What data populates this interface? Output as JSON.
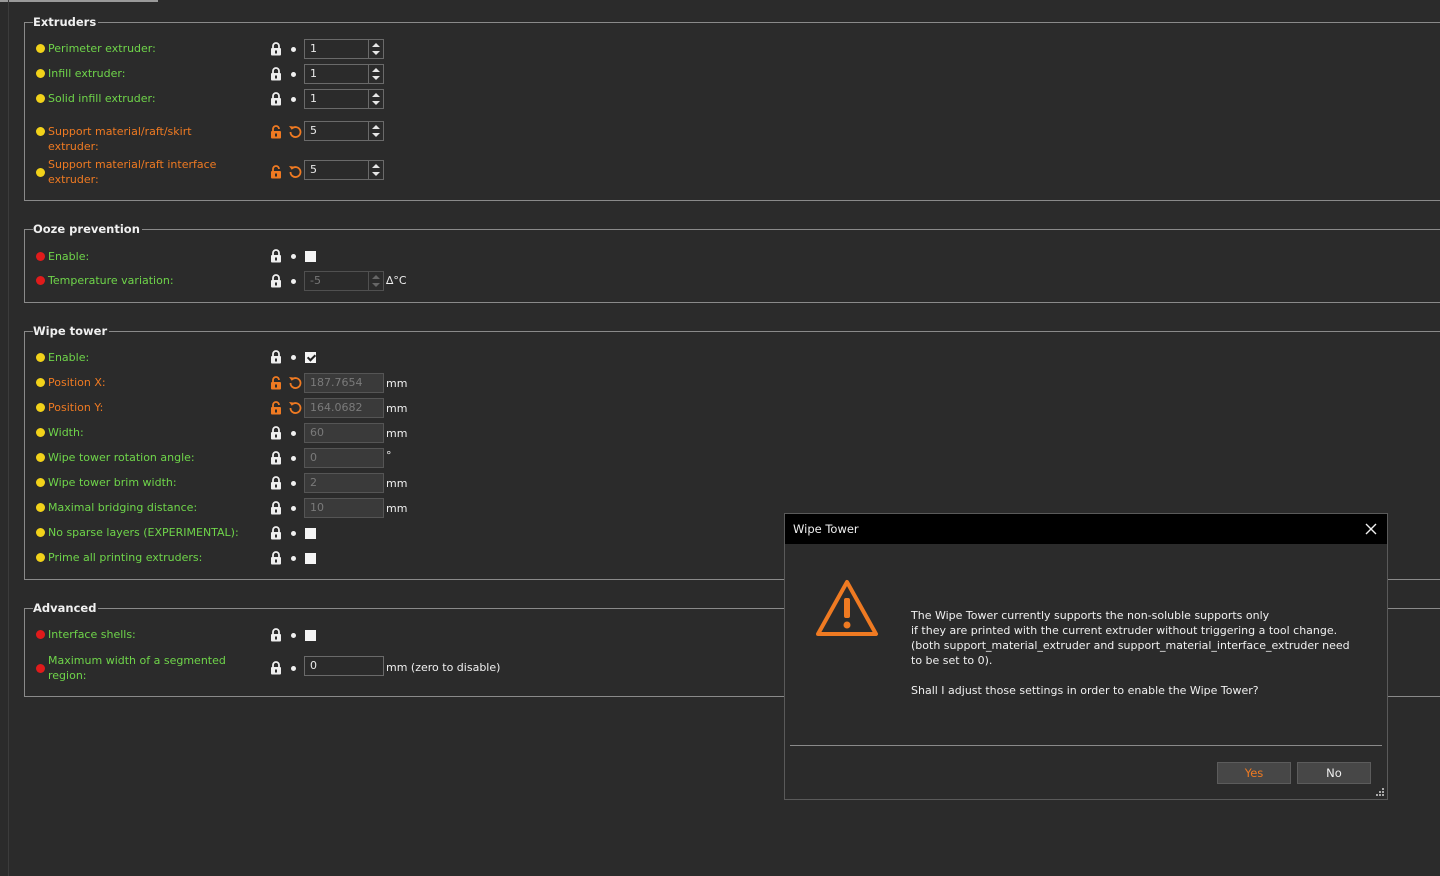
{
  "extruders": {
    "title": "Extruders",
    "rows": [
      {
        "label": "Perimeter extruder:",
        "value": "1"
      },
      {
        "label": "Infill extruder:",
        "value": "1"
      },
      {
        "label": "Solid infill extruder:",
        "value": "1"
      },
      {
        "label": "Support material/raft/skirt extruder:",
        "value": "5"
      },
      {
        "label": "Support material/raft interface extruder:",
        "value": "5"
      }
    ]
  },
  "ooze": {
    "title": "Ooze prevention",
    "enable_label": "Enable:",
    "temp_label": "Temperature variation:",
    "temp_value": "-5",
    "temp_unit": "∆°C"
  },
  "wipe": {
    "title": "Wipe tower",
    "enable_label": "Enable:",
    "rows": [
      {
        "label": "Position X:",
        "value": "187.7654",
        "unit": "mm"
      },
      {
        "label": "Position Y:",
        "value": "164.0682",
        "unit": "mm"
      },
      {
        "label": "Width:",
        "value": "60",
        "unit": "mm"
      },
      {
        "label": "Wipe tower rotation angle:",
        "value": "0",
        "unit": "°"
      },
      {
        "label": "Wipe tower brim width:",
        "value": "2",
        "unit": "mm"
      },
      {
        "label": "Maximal bridging distance:",
        "value": "10",
        "unit": "mm"
      }
    ],
    "no_sparse_label": "No sparse layers (EXPERIMENTAL):",
    "prime_label": "Prime all printing extruders:"
  },
  "advanced": {
    "title": "Advanced",
    "shells_label": "Interface shells:",
    "maxwidth_label": "Maximum width of a segmented region:",
    "maxwidth_value": "0",
    "maxwidth_unit": "mm (zero to disable)"
  },
  "dialog": {
    "title": "Wipe Tower",
    "line1": "The Wipe Tower currently supports the non-soluble supports only",
    "line2": "if they are printed with the current extruder without triggering a tool change.",
    "line3": "(both support_material_extruder and support_material_interface_extruder need to be set to 0).",
    "question": "Shall I adjust those settings in order to enable the Wipe Tower?",
    "yes": "Yes",
    "no": "No"
  },
  "colors": {
    "background": "#2b2b2b",
    "system_value_green": "#6fd54a",
    "modified_value_orange": "#ef7a22",
    "dot_yellow": "#f2d21a",
    "dot_red": "#e01b1b",
    "title_bar": "#000000"
  }
}
